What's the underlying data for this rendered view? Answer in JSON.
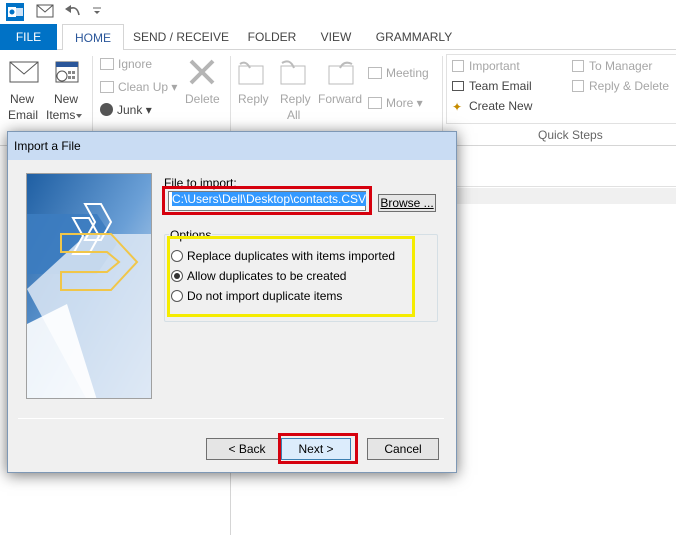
{
  "qat": {
    "app_icon": "outlook-icon",
    "items": [
      "mail-icon",
      "undo-icon",
      "customize-dropdown-icon"
    ]
  },
  "tabs": [
    "FILE",
    "HOME",
    "SEND / RECEIVE",
    "FOLDER",
    "VIEW",
    "GRAMMARLY"
  ],
  "ribbon": {
    "new_email": [
      "New",
      "Email"
    ],
    "new_items": [
      "New",
      "Items"
    ],
    "ignore": "Ignore",
    "clean_up": "Clean Up",
    "junk": "Junk",
    "delete": "Delete",
    "reply": "Reply",
    "reply_all": [
      "Reply",
      "All"
    ],
    "forward": "Forward",
    "meeting": "Meeting",
    "more": "More",
    "quick_steps": [
      "Important",
      "Team Email",
      "Create New",
      "To Manager",
      "Reply & Delete"
    ],
    "quick_steps_label": "Quick Steps"
  },
  "dialog": {
    "title": "Import a File",
    "file_label": "File to import:",
    "file_value": "C:\\Users\\Dell\\Desktop\\contacts.CSV",
    "browse": "Browse ...",
    "options_legend": "Options",
    "options": [
      {
        "label": "Replace duplicates with items imported",
        "selected": false
      },
      {
        "label": "Allow duplicates to be created",
        "selected": true
      },
      {
        "label": "Do not import duplicate items",
        "selected": false
      }
    ],
    "back": "< Back",
    "next": "Next >",
    "cancel": "Cancel"
  },
  "colors": {
    "accent": "#0072c6",
    "highlight_red": "#d6000d",
    "highlight_yellow": "#f5ec00",
    "title_bar": "#c9dcf3"
  }
}
